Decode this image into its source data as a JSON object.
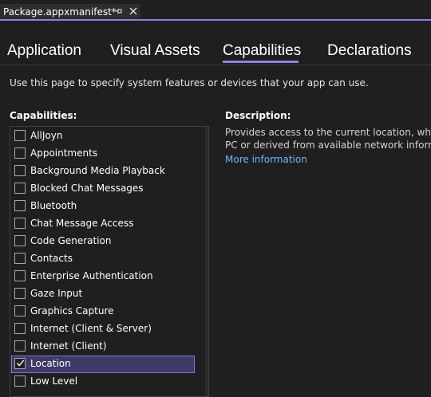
{
  "document_tab": {
    "title": "Package.appxmanifest*",
    "pin_icon": "pin-icon",
    "close_icon": "close-icon"
  },
  "section_tabs": [
    {
      "label": "Application"
    },
    {
      "label": "Visual Assets"
    },
    {
      "label": "Capabilities",
      "selected": true
    },
    {
      "label": "Declarations"
    }
  ],
  "intro_text": "Use this page to specify system features or devices that your app can use.",
  "capabilities_heading": "Capabilities:",
  "description_heading": "Description:",
  "description_lines": [
    "Provides access to the current location, which is o",
    "PC or derived from available network informatio"
  ],
  "more_information": "More information",
  "capabilities": [
    {
      "label": "AllJoyn",
      "checked": false
    },
    {
      "label": "Appointments",
      "checked": false
    },
    {
      "label": "Background Media Playback",
      "checked": false
    },
    {
      "label": "Blocked Chat Messages",
      "checked": false
    },
    {
      "label": "Bluetooth",
      "checked": false
    },
    {
      "label": "Chat Message Access",
      "checked": false
    },
    {
      "label": "Code Generation",
      "checked": false
    },
    {
      "label": "Contacts",
      "checked": false
    },
    {
      "label": "Enterprise Authentication",
      "checked": false
    },
    {
      "label": "Gaze Input",
      "checked": false
    },
    {
      "label": "Graphics Capture",
      "checked": false
    },
    {
      "label": "Internet (Client & Server)",
      "checked": false
    },
    {
      "label": "Internet (Client)",
      "checked": false
    },
    {
      "label": "Location",
      "checked": true,
      "selected": true
    },
    {
      "label": "Low Level",
      "checked": false
    }
  ],
  "colors": {
    "accent": "#8f7fe0",
    "link": "#6fb6ff",
    "selected_row": "#3e3a68",
    "background": "#1f1f1f"
  }
}
